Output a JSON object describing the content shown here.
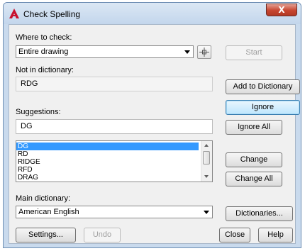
{
  "window": {
    "title": "Check Spelling",
    "close_glyph": "X"
  },
  "where_to_check": {
    "label": "Where to check:",
    "value": "Entire drawing"
  },
  "buttons": {
    "start": "Start",
    "add_to_dictionary": "Add to Dictionary",
    "ignore": "Ignore",
    "ignore_all": "Ignore All",
    "change": "Change",
    "change_all": "Change All",
    "dictionaries": "Dictionaries...",
    "settings": "Settings...",
    "undo": "Undo",
    "close": "Close",
    "help": "Help"
  },
  "not_in_dictionary": {
    "label": "Not in dictionary:",
    "value": "RDG"
  },
  "suggestions": {
    "label": "Suggestions:",
    "value": "DG",
    "items": [
      "DG",
      "RD",
      "RIDGE",
      "RFD",
      "DRAG"
    ],
    "selected_index": 0
  },
  "main_dictionary": {
    "label": "Main dictionary:",
    "value": "American English"
  },
  "icons": {
    "app": "autocad-logo-icon",
    "pick": "crosshair-pick-icon",
    "close": "close-icon"
  },
  "colors": {
    "accent_red": "#c7452f",
    "selection": "#3399ff",
    "default_button": "#3c7fb1"
  }
}
